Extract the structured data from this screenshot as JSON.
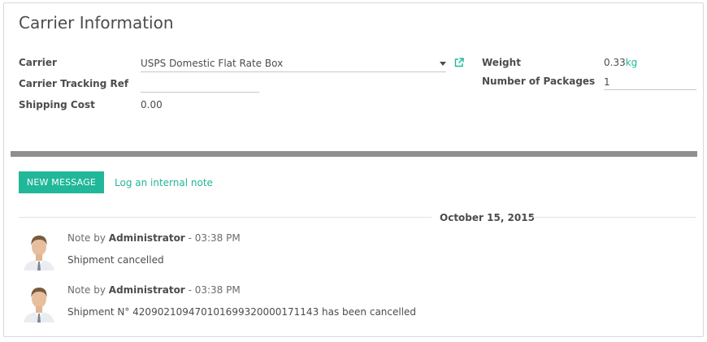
{
  "section": {
    "title": "Carrier Information"
  },
  "fields": {
    "carrier_label": "Carrier",
    "carrier_value": "USPS Domestic Flat Rate Box",
    "tracking_label": "Carrier Tracking Ref",
    "tracking_value": "",
    "shipping_cost_label": "Shipping Cost",
    "shipping_cost_value": "0.00",
    "weight_label": "Weight",
    "weight_value": "0.33",
    "weight_unit": "kg",
    "packages_label": "Number of Packages",
    "packages_value": "1"
  },
  "chatter": {
    "new_message_label": "NEW MESSAGE",
    "log_note_label": "Log an internal note",
    "date_separator": "October 15, 2015",
    "messages": [
      {
        "prefix": "Note by",
        "author": "Administrator",
        "time": "- 03:38 PM",
        "body": "Shipment cancelled"
      },
      {
        "prefix": "Note by",
        "author": "Administrator",
        "time": "- 03:38 PM",
        "body": "Shipment N° 420902109470101699320000171143 has been cancelled"
      }
    ]
  },
  "colors": {
    "accent": "#21b799",
    "divider": "#8f8f8f"
  },
  "icons": {
    "carrier_dropdown": "caret-down-icon",
    "carrier_open": "external-link-icon",
    "avatar": "user-avatar"
  }
}
